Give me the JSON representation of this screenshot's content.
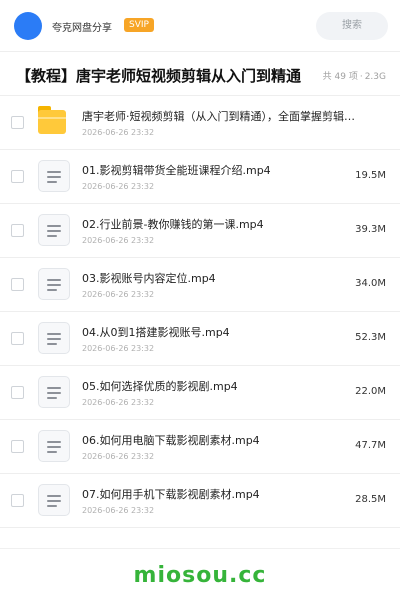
{
  "header": {
    "username": "夸克网盘分享",
    "badge": "SVIP",
    "search_label": "搜索"
  },
  "share": {
    "title": "【教程】唐宇老师短视频剪辑从入门到精通",
    "count": "共 49 项",
    "separator": "·",
    "total_size": "2.3G"
  },
  "items": [
    {
      "type": "folder",
      "name": "唐宇老师·短视频剪辑（从入门到精通），全面掌握剪辑…",
      "date": "2026-06-26 23:32",
      "size": ""
    },
    {
      "type": "file",
      "name": "01.影视剪辑带货全能班课程介绍.mp4",
      "date": "2026-06-26 23:32",
      "size": "19.5M"
    },
    {
      "type": "file",
      "name": "02.行业前景-教你赚钱的第一课.mp4",
      "date": "2026-06-26 23:32",
      "size": "39.3M"
    },
    {
      "type": "file",
      "name": "03.影视账号内容定位.mp4",
      "date": "2026-06-26 23:32",
      "size": "34.0M"
    },
    {
      "type": "file",
      "name": "04.从0到1搭建影视账号.mp4",
      "date": "2026-06-26 23:32",
      "size": "52.3M"
    },
    {
      "type": "file",
      "name": "05.如何选择优质的影视剧.mp4",
      "date": "2026-06-26 23:32",
      "size": "22.0M"
    },
    {
      "type": "file",
      "name": "06.如何用电脑下载影视剧素材.mp4",
      "date": "2026-06-26 23:32",
      "size": "47.7M"
    },
    {
      "type": "file",
      "name": "07.如何用手机下载影视剧素材.mp4",
      "date": "2026-06-26 23:32",
      "size": "28.5M"
    }
  ],
  "watermark": "miosou.cc",
  "colors": {
    "avatar": "#2b7cf6",
    "svip_badge": "#f7a526",
    "folder": "#ffc93a",
    "watermark": "#36b43a"
  },
  "icons": {
    "folder": "folder-icon",
    "file": "video-file-icon"
  }
}
